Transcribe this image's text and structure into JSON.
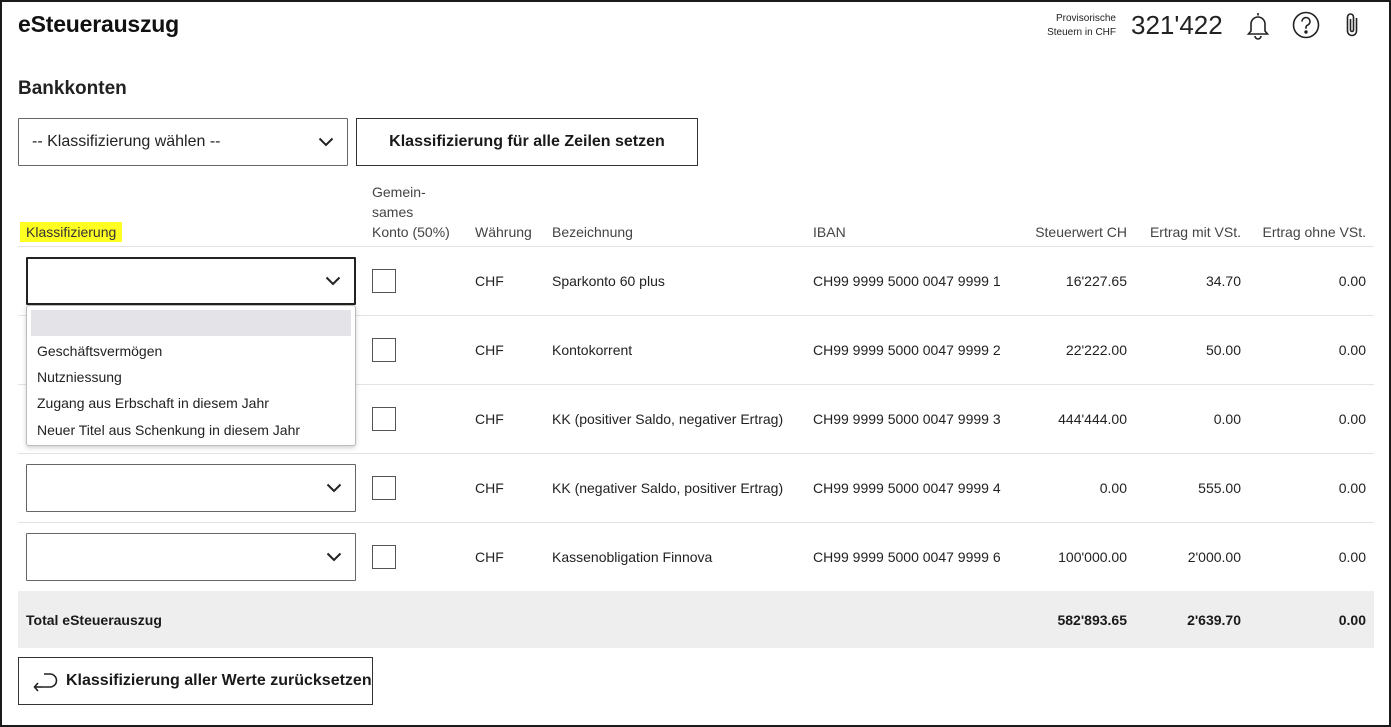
{
  "header": {
    "app_title": "eSteuerauszug",
    "provisional_label_line1": "Provisorische",
    "provisional_label_line2": "Steuern in CHF",
    "provisional_value": "321'422",
    "icons": [
      "bell-icon",
      "help-icon",
      "paperclip-icon"
    ]
  },
  "section_title": "Bankkonten",
  "toolbar": {
    "classification_select": "-- Klassifizierung wählen --",
    "apply_all_button": "Klassifizierung für alle Zeilen setzen"
  },
  "table": {
    "headers": {
      "klassifizierung": "Klassifizierung",
      "gemeinsam_line1": "Gemein-",
      "gemeinsam_line2": "sames",
      "gemeinsam_line3": "Konto (50%)",
      "waehrung": "Währung",
      "bezeichnung": "Bezeichnung",
      "iban": "IBAN",
      "steuerwert": "Steuerwert CH",
      "ertrag_mit": "Ertrag mit VSt.",
      "ertrag_ohne": "Ertrag ohne VSt."
    },
    "rows": [
      {
        "classification": "",
        "joint": false,
        "currency": "CHF",
        "name": "Sparkonto 60 plus",
        "iban": "CH99 9999 5000 0047 9999 1",
        "tax_value": "16'227.65",
        "income_with_wht": "34.70",
        "income_without_wht": "0.00"
      },
      {
        "classification": "",
        "joint": false,
        "currency": "CHF",
        "name": "Kontokorrent",
        "iban": "CH99 9999 5000 0047 9999 2",
        "tax_value": "22'222.00",
        "income_with_wht": "50.00",
        "income_without_wht": "0.00"
      },
      {
        "classification": "",
        "joint": false,
        "currency": "CHF",
        "name": "KK (positiver Saldo, negativer Ertrag)",
        "iban": "CH99 9999 5000 0047 9999 3",
        "tax_value": "444'444.00",
        "income_with_wht": "0.00",
        "income_without_wht": "0.00"
      },
      {
        "classification": "",
        "joint": false,
        "currency": "CHF",
        "name": "KK (negativer Saldo, positiver Ertrag)",
        "iban": "CH99 9999 5000 0047 9999 4",
        "tax_value": "0.00",
        "income_with_wht": "555.00",
        "income_without_wht": "0.00"
      },
      {
        "classification": "",
        "joint": false,
        "currency": "CHF",
        "name": "Kassenobligation Finnova",
        "iban": "CH99 9999 5000 0047 9999 6",
        "tax_value": "100'000.00",
        "income_with_wht": "2'000.00",
        "income_without_wht": "0.00"
      }
    ],
    "total": {
      "label": "Total eSteuerauszug",
      "tax_value": "582'893.65",
      "income_with_wht": "2'639.70",
      "income_without_wht": "0.00"
    }
  },
  "dropdown_options": [
    "",
    "Geschäftsvermögen",
    "Nutzniessung",
    "Zugang aus Erbschaft in diesem Jahr",
    "Neuer Titel aus Schenkung in diesem Jahr"
  ],
  "reset_button": "Klassifizierung aller Werte zurücksetzen",
  "colors": {
    "highlight": "#ffff22",
    "total_row_bg": "#efeeee",
    "border": "#1a1a1a"
  }
}
